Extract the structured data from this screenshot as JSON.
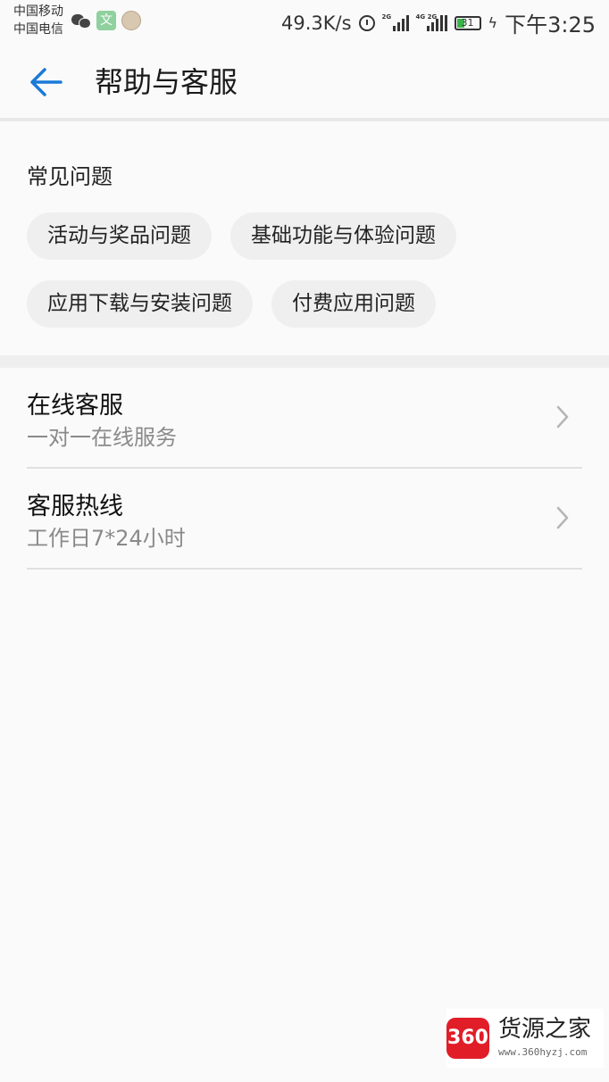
{
  "status_bar": {
    "carrier_1": "中国移动",
    "carrier_2": "中国电信",
    "app_icon_text": "文",
    "net_speed": "49.3K/s",
    "signal_1_tag": "2G",
    "signal_2_tag": "4G 2G",
    "battery_level": "31",
    "charging_icon": "lightning-icon",
    "time": "下午3:25"
  },
  "header": {
    "back_icon": "arrow-left-icon",
    "title": "帮助与客服"
  },
  "faq": {
    "title": "常见问题",
    "chips": [
      {
        "label": "活动与奖品问题"
      },
      {
        "label": "基础功能与体验问题"
      },
      {
        "label": "应用下载与安装问题"
      },
      {
        "label": "付费应用问题"
      }
    ]
  },
  "list": [
    {
      "title": "在线客服",
      "subtitle": "一对一在线服务"
    },
    {
      "title": "客服热线",
      "subtitle": "工作日7*24小时"
    }
  ],
  "watermark": {
    "badge": "360",
    "name": "货源之家",
    "url": "www.360hyzj.com"
  },
  "colors": {
    "accent": "#1a7ad8",
    "background": "#fafafa",
    "chip_bg": "#efefef",
    "battery_fill": "#3ab54a",
    "watermark_red": "#e11d28"
  }
}
